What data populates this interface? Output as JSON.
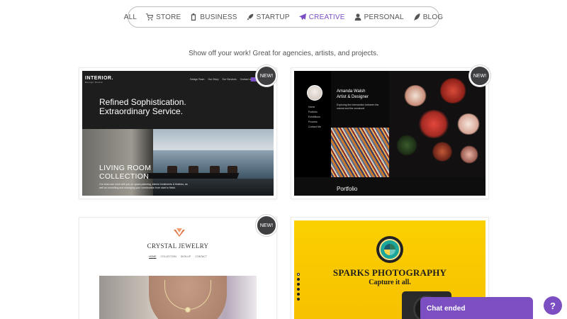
{
  "filters": [
    {
      "label": "ALL",
      "icon": "none",
      "active": false
    },
    {
      "label": "STORE",
      "icon": "cart-icon",
      "active": false
    },
    {
      "label": "BUSINESS",
      "icon": "clipboard-icon",
      "active": false
    },
    {
      "label": "STARTUP",
      "icon": "rocket-icon",
      "active": false
    },
    {
      "label": "CREATIVE",
      "icon": "paper-plane-icon",
      "active": true
    },
    {
      "label": "PERSONAL",
      "icon": "person-icon",
      "active": false
    },
    {
      "label": "BLOG",
      "icon": "quill-icon",
      "active": false
    }
  ],
  "tagline": "Show off your work! Great for agencies, artists, and projects.",
  "badge_label": "NEW!",
  "cards": {
    "interior": {
      "logo": "INTERIOR.",
      "logo_sub": "Design Studio",
      "nav": [
        "Design Team",
        "Our Story",
        "Our Services",
        "Contact Us"
      ],
      "headline_1": "Refined Sophistication.",
      "headline_2": "Extraordinary Service.",
      "collection_1": "LIVING ROOM",
      "collection_2": "COLLECTION",
      "body": "Our team can work with you on space planning, interior treatments & finishes, as well as consulting and managing your construction from start to finish."
    },
    "portfolio": {
      "name_1": "Amanda Walsh",
      "name_2": "Artist & Designer",
      "nav": [
        "Home",
        "Portfolio",
        "Exhibitions",
        "Process",
        "Contact Me"
      ],
      "desc": "Exploring the intersection between the natural and the unnatural.",
      "title": "Portfolio"
    },
    "jewelry": {
      "brand": "CRYSTAL JEWELRY",
      "nav": [
        "HOME",
        "COLLECTION",
        "SIGN UP",
        "CONTACT"
      ]
    },
    "photography": {
      "title": "SPARKS PHOTOGRAPHY",
      "subtitle": "Capture it all."
    }
  },
  "chat": {
    "label": "Chat ended"
  },
  "help": {
    "label": "?"
  },
  "colors": {
    "accent": "#7b4fc1",
    "badge": "#3f3f42",
    "yellow": "#f9c800"
  }
}
